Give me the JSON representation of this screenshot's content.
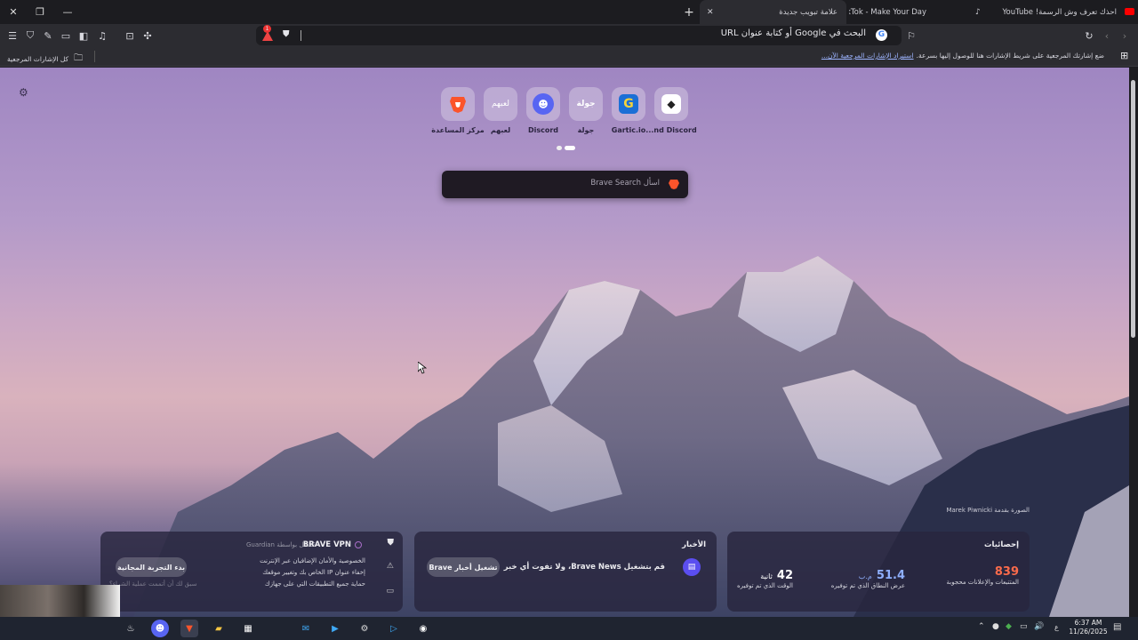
{
  "tabs": [
    {
      "title": "احذك تعرف وش الرسمة! YouTube - ..."
    },
    {
      "title": "TikTok - Make Your Day"
    },
    {
      "title": "علامة تبويب جديدة",
      "active": true
    }
  ],
  "toolbar": {
    "url_placeholder": "البحث في Google أو كتابة عنوان URL",
    "shield_badge": "1"
  },
  "bookmarks": {
    "all_bookmarks": "كل الإشارات المرجعية",
    "hint": "ضع إشارتك المرجعية على شريط الإشارات هنا للوصول إليها بسرعة.",
    "import_link": "استيراد الإشارات المرجعية الآن..."
  },
  "top_sites": [
    {
      "label": "...nd Discord",
      "icon": "robot-icon",
      "color": "#ffffff"
    },
    {
      "label": "Gartic.io",
      "icon": "gartic-icon",
      "color": "#1b6fd6"
    },
    {
      "label": "جولة",
      "icon": "tour-text-icon",
      "glyph": "جولة"
    },
    {
      "label": "Discord",
      "icon": "discord-icon",
      "color": "#5865f2"
    },
    {
      "label": "لعبهم",
      "icon": "play-text-icon",
      "glyph": "لعبهم"
    },
    {
      "label": "مركز المساعدة",
      "icon": "brave-lion-icon",
      "color": "#fb542b"
    }
  ],
  "search": {
    "placeholder": "اسأل Brave Search"
  },
  "photo_credit": "الصورة بقدمة Marek Piwnicki",
  "stats": {
    "title": "إحصائيات",
    "blocked_value": "839",
    "blocked_label": "المتتبعات والإعلانات محجوبة",
    "bandwidth_value": "51.4",
    "bandwidth_unit": "م.ب",
    "bandwidth_label": "عرض النطاق الذي تم توفيره",
    "time_value": "42",
    "time_unit": "ثانية",
    "time_label": "الوقت الذي تم توفيره"
  },
  "news": {
    "title": "الأخبار",
    "message": "قم بتشغيل Brave News، ولا تفوت أي خبر",
    "button": "تشغيل أخبار Brave"
  },
  "vpn": {
    "title": "BRAVE VPN",
    "powered": "مُشغّل بواسطة Guardian",
    "features": [
      "الخصوصية والأمان الإضافيان عبر الإنترنت",
      "إخفاء عنوان IP الخاص بك وتغيير موقعك",
      "حماية جميع التطبيقات التي على جهازك"
    ],
    "button": "بدء التجربة المجانية",
    "footnote": "سبق لك أن أتممت عملية الشراء؟"
  },
  "system": {
    "time": "6:37 AM",
    "date": "11/26/2025",
    "lang": "ع"
  }
}
